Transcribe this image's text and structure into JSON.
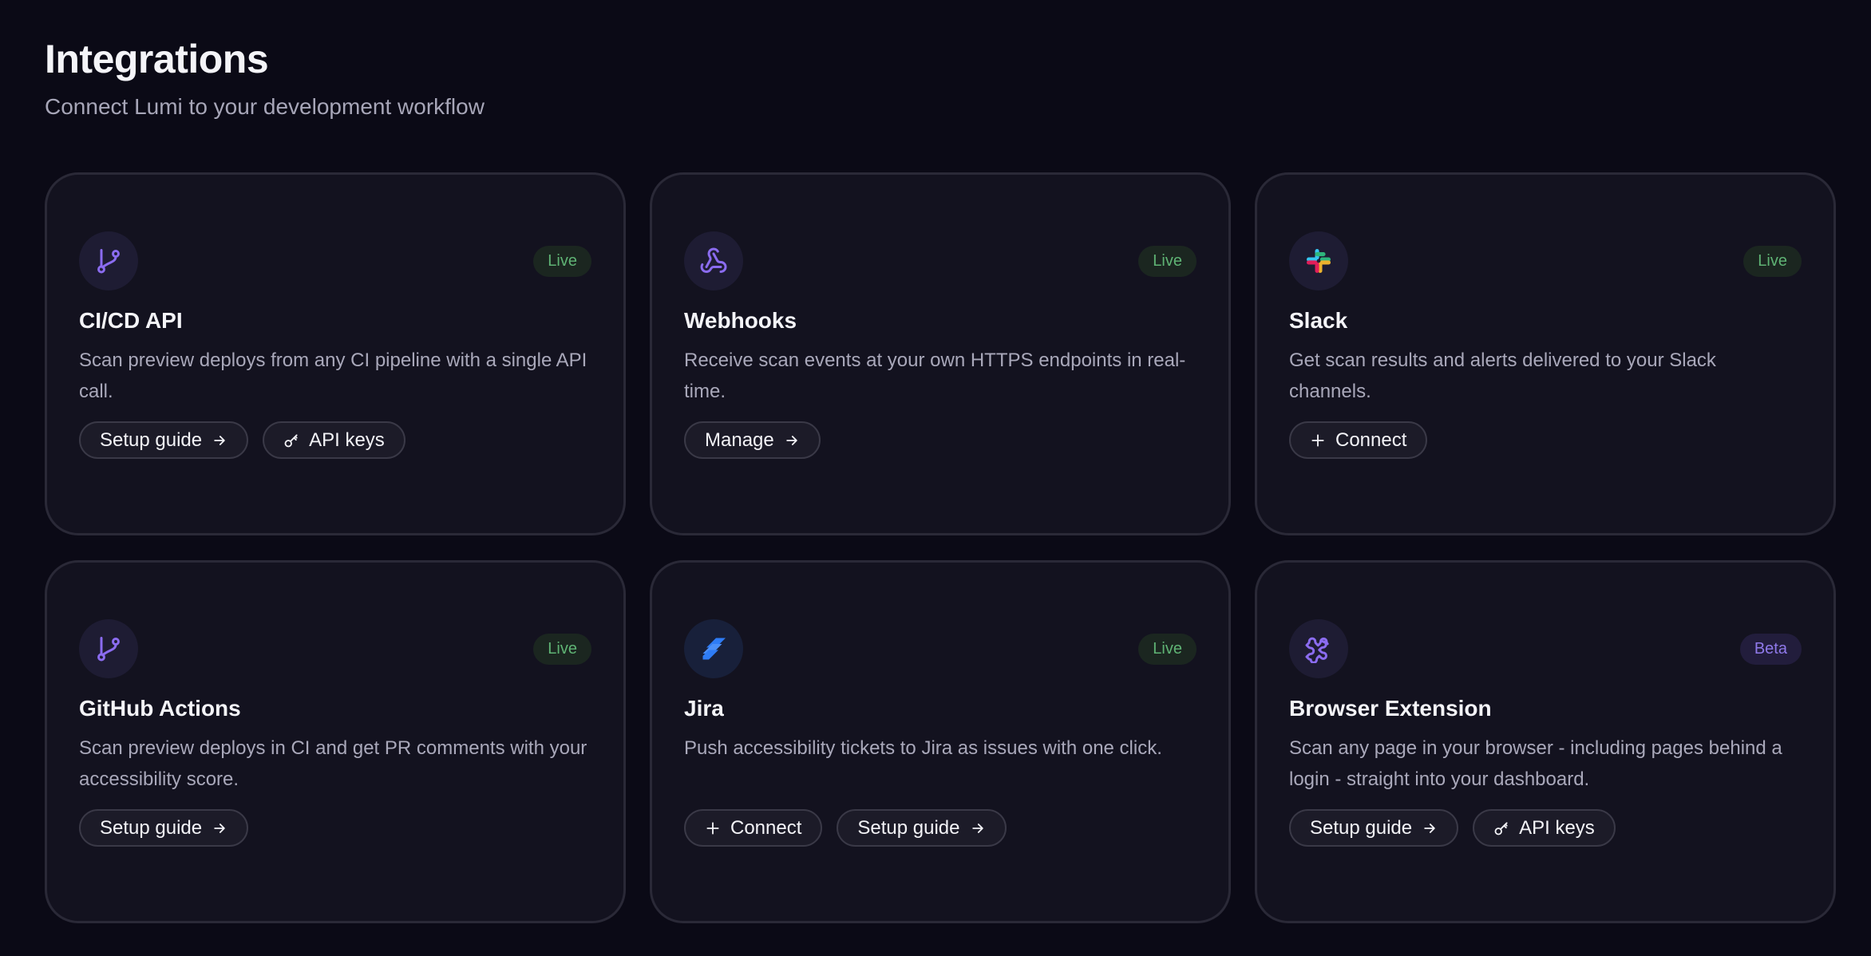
{
  "header": {
    "title": "Integrations",
    "subtitle": "Connect Lumi to your development workflow"
  },
  "colors": {
    "background": "#0b0a16",
    "card": "#13121f",
    "accent": "#8b6cf0",
    "live": "#5fb374",
    "beta": "#8f79ea"
  },
  "cards": [
    {
      "icon": "git-branch-icon",
      "status": "Live",
      "title": "CI/CD API",
      "description": "Scan preview deploys from any CI pipeline with a single API call.",
      "actions": [
        {
          "label": "Setup guide",
          "icon": "arrow-right-icon"
        },
        {
          "label": "API keys",
          "icon": "key-icon"
        }
      ]
    },
    {
      "icon": "webhook-icon",
      "status": "Live",
      "title": "Webhooks",
      "description": "Receive scan events at your own HTTPS endpoints in real-time.",
      "actions": [
        {
          "label": "Manage",
          "icon": "arrow-right-icon"
        }
      ]
    },
    {
      "icon": "slack-icon",
      "status": "Live",
      "title": "Slack",
      "description": "Get scan results and alerts delivered to your Slack channels.",
      "actions": [
        {
          "label": "Connect",
          "icon": "plus-icon"
        }
      ]
    },
    {
      "icon": "git-branch-icon",
      "status": "Live",
      "title": "GitHub Actions",
      "description": "Scan preview deploys in CI and get PR comments with your accessibility score.",
      "actions": [
        {
          "label": "Setup guide",
          "icon": "arrow-right-icon"
        }
      ]
    },
    {
      "icon": "jira-icon",
      "status": "Live",
      "title": "Jira",
      "description": "Push accessibility tickets to Jira as issues with one click.",
      "actions": [
        {
          "label": "Connect",
          "icon": "plus-icon"
        },
        {
          "label": "Setup guide",
          "icon": "arrow-right-icon"
        }
      ]
    },
    {
      "icon": "puzzle-icon",
      "status": "Beta",
      "title": "Browser Extension",
      "description": "Scan any page in your browser - including pages behind a login - straight into your dashboard.",
      "actions": [
        {
          "label": "Setup guide",
          "icon": "arrow-right-icon"
        },
        {
          "label": "API keys",
          "icon": "key-icon"
        }
      ]
    }
  ]
}
